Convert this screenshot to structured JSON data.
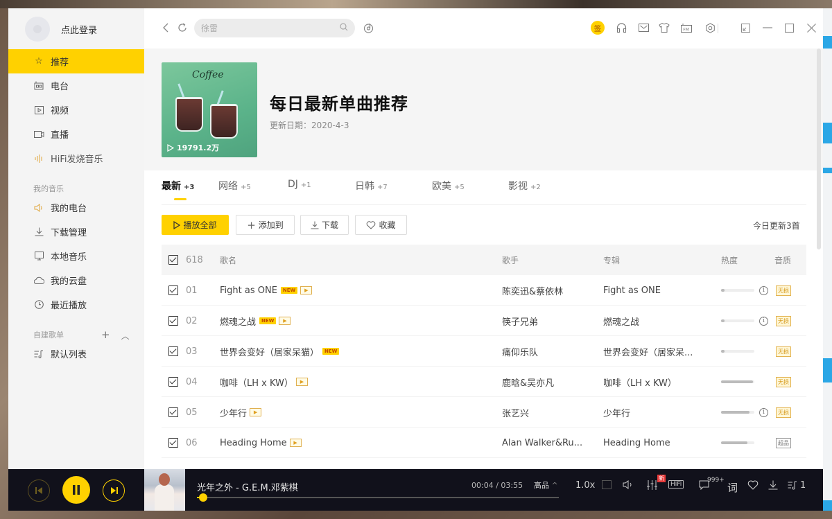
{
  "sidebar": {
    "login_label": "点此登录",
    "top_items": [
      {
        "label": "推荐",
        "icon": "star-icon",
        "active": true
      },
      {
        "label": "电台",
        "icon": "radio-icon"
      },
      {
        "label": "视频",
        "icon": "video-icon"
      },
      {
        "label": "直播",
        "icon": "live-camera-icon"
      },
      {
        "label": "HiFi发烧音乐",
        "icon": "hifi-wave-icon"
      }
    ],
    "my_music_label": "我的音乐",
    "my_music_items": [
      {
        "label": "我的电台",
        "icon": "speaker-icon"
      },
      {
        "label": "下载管理",
        "icon": "download-icon"
      },
      {
        "label": "本地音乐",
        "icon": "monitor-icon"
      },
      {
        "label": "我的云盘",
        "icon": "cloud-icon"
      },
      {
        "label": "最近播放",
        "icon": "clock-icon"
      }
    ],
    "playlists_label": "自建歌单",
    "playlists": [
      {
        "label": "默认列表",
        "icon": "playlist-icon"
      }
    ]
  },
  "topbar": {
    "search_placeholder": "徐雷",
    "vip_label": "签"
  },
  "header": {
    "cover_title": "Coffee",
    "play_count": "19791.2万",
    "title": "每日最新单曲推荐",
    "update_date": "更新日期：2020-4-3"
  },
  "tabs": [
    {
      "label": "最新",
      "count": "+3",
      "active": true
    },
    {
      "label": "网络",
      "count": "+5"
    },
    {
      "label": "DJ",
      "count": "+1"
    },
    {
      "label": "日韩",
      "count": "+7"
    },
    {
      "label": "欧美",
      "count": "+5"
    },
    {
      "label": "影视",
      "count": "+2"
    }
  ],
  "actions": {
    "play_all": "播放全部",
    "add_to": "添加到",
    "download": "下载",
    "favorite": "收藏",
    "today_update": "今日更新3首"
  },
  "table": {
    "total": "618",
    "headers": {
      "name": "歌名",
      "artist": "歌手",
      "album": "专辑",
      "heat": "热度",
      "quality": "音质"
    },
    "rows": [
      {
        "index": "01",
        "name": "Fight as ONE",
        "new": true,
        "mv": true,
        "artist": "陈奕迅&蔡依林",
        "album": "Fight as ONE",
        "heat": 0.1,
        "info": true,
        "quality": "无损"
      },
      {
        "index": "02",
        "name": "燃魂之战",
        "new": true,
        "mv": true,
        "artist": "筷子兄弟",
        "album": "燃魂之战",
        "heat": 0.1,
        "info": true,
        "quality": "无损"
      },
      {
        "index": "03",
        "name": "世界会变好（居家呆猫）",
        "new": true,
        "mv": false,
        "artist": "痛仰乐队",
        "album": "世界会变好（居家呆...",
        "heat": 0.1,
        "info": false,
        "quality": "无损"
      },
      {
        "index": "04",
        "name": "咖啡（LH x KW）",
        "new": false,
        "mv": true,
        "artist": "鹿晗&吴亦凡",
        "album": "咖啡（LH x KW）",
        "heat": 0.95,
        "info": false,
        "quality": "无损"
      },
      {
        "index": "05",
        "name": "少年行",
        "new": false,
        "mv": true,
        "artist": "张艺兴",
        "album": "少年行",
        "heat": 0.85,
        "info": true,
        "quality": "无损"
      },
      {
        "index": "06",
        "name": "Heading Home",
        "new": false,
        "mv": true,
        "artist": "Alan Walker&Ru...",
        "album": "Heading Home",
        "heat": 0.8,
        "info": false,
        "quality": "超品"
      }
    ],
    "new_tag": "NEW"
  },
  "player": {
    "track": "光年之外  - G.E.M.邓紫棋",
    "current_time": "00:04",
    "total_time": "03:55",
    "time_display": "00:04 / 03:55",
    "progress": 0.017,
    "quality": "高品",
    "speed": "1.0x",
    "eq_badge": "新",
    "hifi_label": "HiFi",
    "comments_count": "999+",
    "lyrics_label": "词",
    "playlist_count": "1"
  }
}
